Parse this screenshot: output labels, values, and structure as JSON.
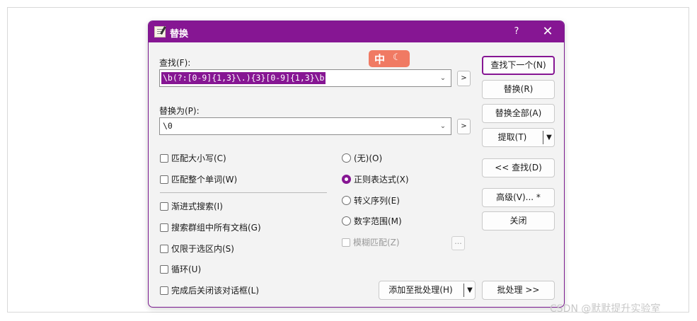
{
  "dialog": {
    "title": "替换",
    "help_label": "?",
    "close_label": "✕"
  },
  "find": {
    "label": "查找(F):",
    "value": "\\b(?:[0-9]{1,3}\\.){3}[0-9]{1,3}\\b",
    "history_arrow": ">"
  },
  "replace": {
    "label": "替换为(P):",
    "value": "\\0",
    "history_arrow": ">"
  },
  "ime": {
    "mode": "中",
    "moon": "☾"
  },
  "options": {
    "match_case": "匹配大小写(C)",
    "match_whole_word": "匹配整个单词(W)",
    "incremental_search": "渐进式搜索(I)",
    "search_all_docs_in_group": "搜索群组中所有文档(G)",
    "in_selection_only": "仅限于选区内(S)",
    "wrap_around": "循环(U)",
    "close_after_done": "完成后关闭该对话框(L)",
    "fuzzy_match": "模糊匹配(Z)",
    "fuzzy_more": "..."
  },
  "modes": {
    "none": "(无)(O)",
    "regex": "正则表达式(X)",
    "escape_seq": "转义序列(E)",
    "number_range": "数字范围(M)",
    "selected": "regex"
  },
  "buttons": {
    "find_next": "查找下一个(N)",
    "replace": "替换(R)",
    "replace_all": "替换全部(A)",
    "extract": "提取(T)",
    "find_less": "<< 查找(D)",
    "advanced": "高级(V)... *",
    "close": "关闭",
    "add_to_batch": "添加至批处理(H)",
    "batch": "批处理 >>"
  },
  "watermark": "CSDN @默默提升实验室",
  "colors": {
    "accent": "#861693",
    "ime_bg": "#f07a63"
  }
}
